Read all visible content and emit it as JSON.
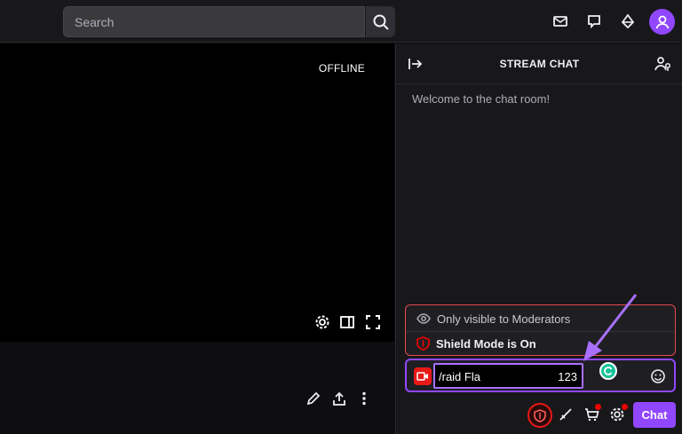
{
  "search": {
    "placeholder": "Search"
  },
  "topbar_icons": [
    "inbox-icon",
    "whispers-icon",
    "prime-icon",
    "user-avatar"
  ],
  "player": {
    "status": "OFFLINE"
  },
  "chat": {
    "title": "STREAM CHAT",
    "welcome": "Welcome to the chat room!",
    "moderator_notice": "Only visible to Moderators",
    "shield_mode": "Shield Mode is On",
    "input_value": "/raid Fla",
    "input_counter": "123",
    "send_label": "Chat"
  },
  "colors": {
    "accent": "#9147ff",
    "shield_red": "#e91916",
    "background": "#0e0e10",
    "panel": "#18181b"
  }
}
